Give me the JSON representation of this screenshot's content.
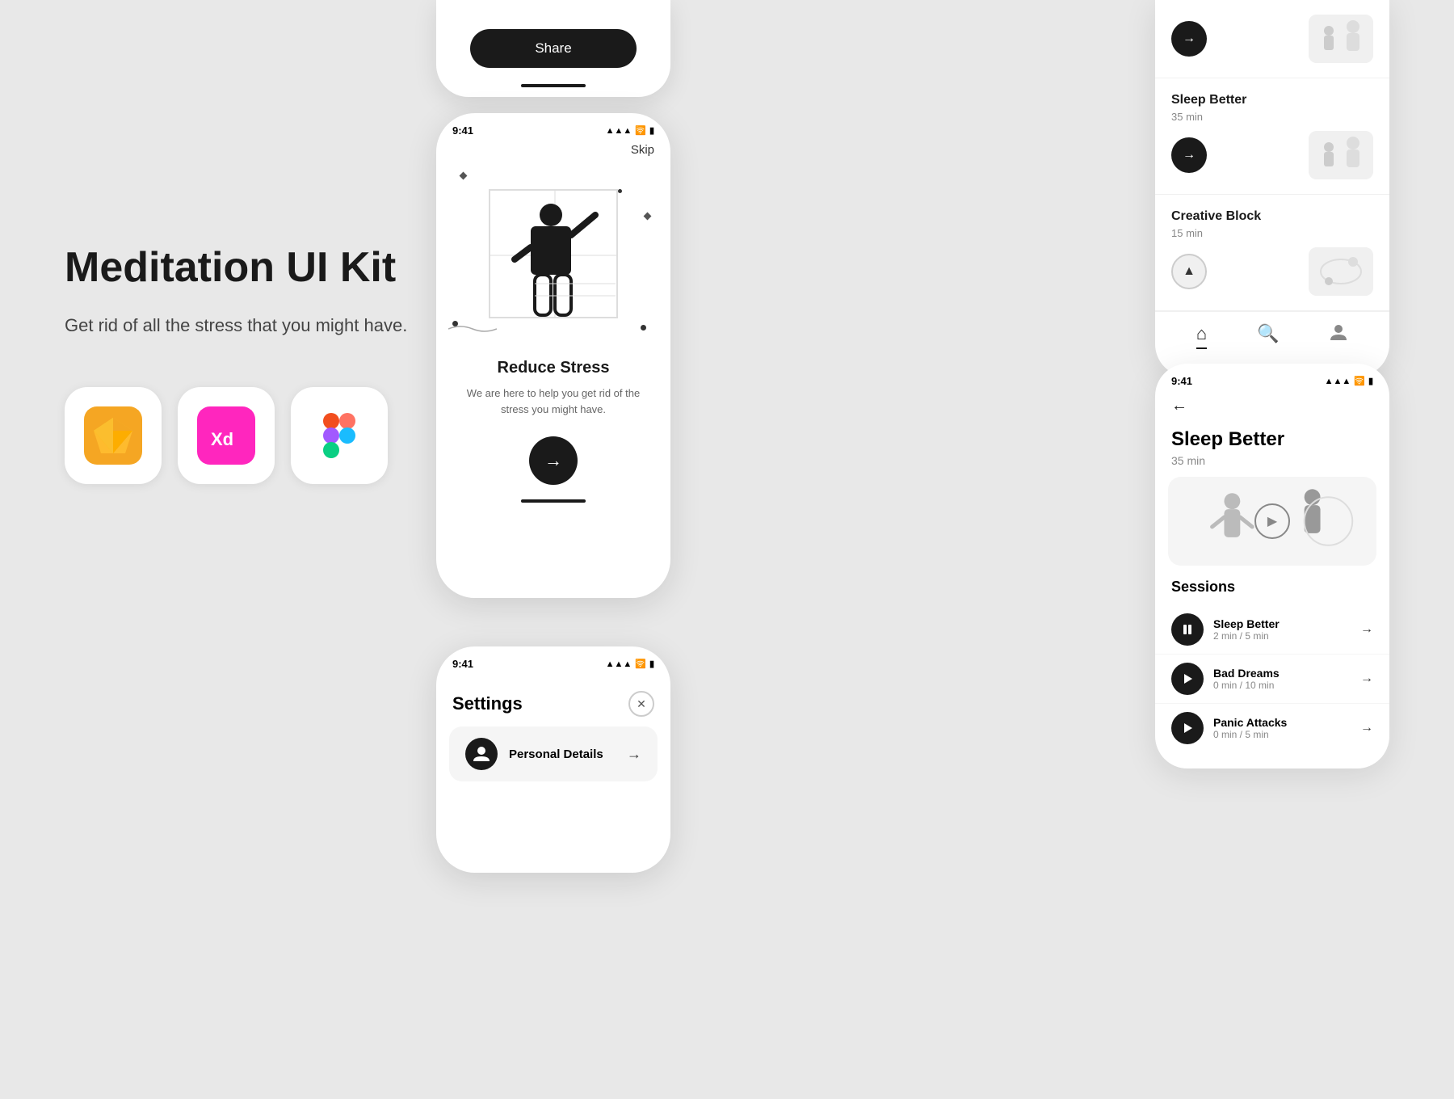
{
  "app": {
    "title": "Meditation UI Kit",
    "subtitle": "Get rid of all the stress that you might have."
  },
  "tools": [
    {
      "name": "Sketch",
      "icon": "💎",
      "bg": "#f5a623"
    },
    {
      "name": "Adobe XD",
      "icon": "Xd",
      "bg": "#ff26be"
    },
    {
      "name": "Figma",
      "icon": "fig",
      "bg": "white"
    }
  ],
  "onboarding": {
    "status_time": "9:41",
    "skip_label": "Skip",
    "title": "Reduce Stress",
    "description": "We are here to help you get rid of the stress you might have.",
    "cta_arrow": "→"
  },
  "settings_screen": {
    "status_time": "9:41",
    "title": "Settings",
    "personal_details_label": "Personal Details",
    "arrow": "→"
  },
  "list_screen": {
    "sessions": [
      {
        "name": "Sleep Better",
        "duration": "35 min"
      },
      {
        "name": "Creative Block",
        "duration": "15 min"
      }
    ],
    "nav_items": [
      "home",
      "search",
      "profile"
    ]
  },
  "detail_screen": {
    "status_time": "9:41",
    "back": "←",
    "title": "Sleep Better",
    "duration": "35 min",
    "sessions_label": "Sessions",
    "session_list": [
      {
        "name": "Sleep Better",
        "sub": "2 min / 5 min",
        "icon": "pause"
      },
      {
        "name": "Bad Dreams",
        "sub": "0 min / 10 min",
        "icon": "play"
      },
      {
        "name": "Panic Attacks",
        "sub": "0 min / 5 min",
        "icon": "play"
      }
    ]
  },
  "share_button": "Share"
}
